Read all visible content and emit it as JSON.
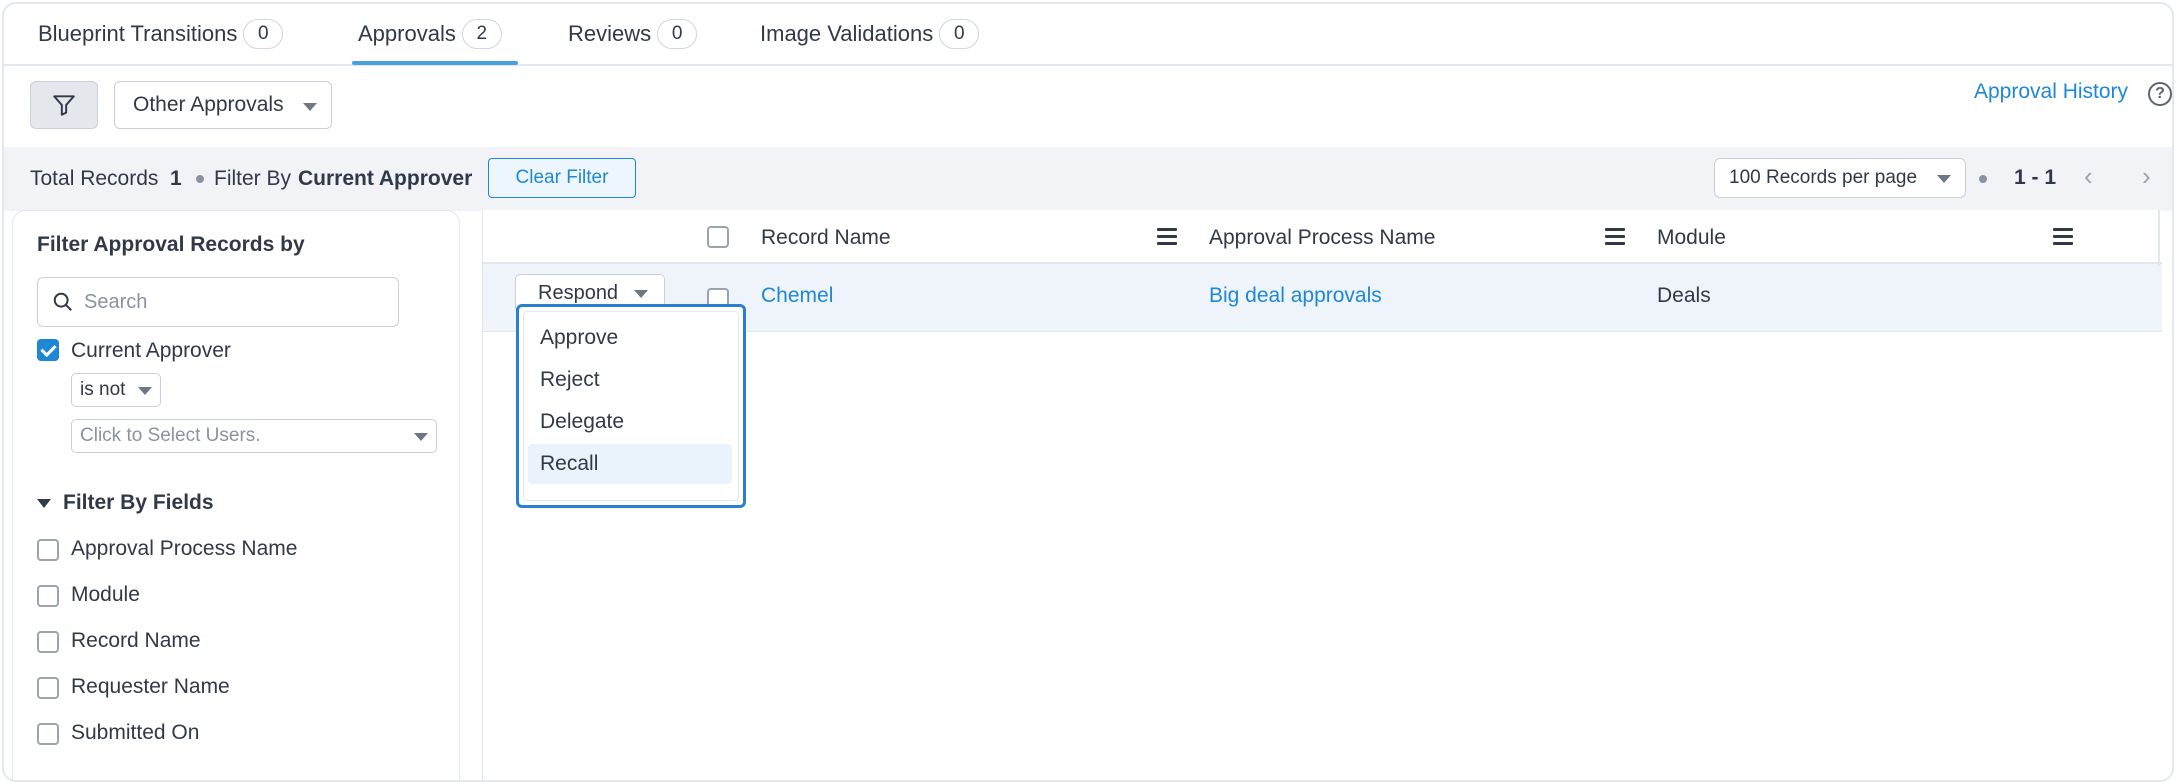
{
  "tabs": [
    {
      "label": "Blueprint Transitions",
      "count": "0"
    },
    {
      "label": "Approvals",
      "count": "2"
    },
    {
      "label": "Reviews",
      "count": "0"
    },
    {
      "label": "Image Validations",
      "count": "0"
    }
  ],
  "active_tab": "Approvals",
  "toolbar": {
    "filter_icon": "funnel-icon",
    "approvals_dropdown": "Other Approvals",
    "approval_history": "Approval History",
    "help_icon": "?"
  },
  "summary": {
    "total_label": "Total Records",
    "total_value": "1",
    "filter_by_label": "Filter By",
    "filter_by_value": "Current Approver",
    "clear_filter": "Clear Filter",
    "records_per_page": "100 Records per page",
    "range": "1 - 1"
  },
  "left_panel": {
    "title": "Filter Approval Records by",
    "search_placeholder": "Search",
    "current_approver": {
      "label": "Current Approver",
      "checked": true
    },
    "operator": "is not",
    "users_placeholder": "Click to Select Users.",
    "filter_by_fields": "Filter By Fields",
    "fields": [
      {
        "label": "Approval Process Name",
        "checked": false
      },
      {
        "label": "Module",
        "checked": false
      },
      {
        "label": "Record Name",
        "checked": false
      },
      {
        "label": "Requester Name",
        "checked": false
      },
      {
        "label": "Submitted On",
        "checked": false
      }
    ]
  },
  "table": {
    "columns": [
      "Record Name",
      "Approval Process Name",
      "Module"
    ],
    "rows": [
      {
        "action": "Respond",
        "record_name": "Chemel",
        "approval_process": "Big deal approvals",
        "module": "Deals"
      }
    ]
  },
  "respond_menu": {
    "items": [
      "Approve",
      "Reject",
      "Delegate",
      "Recall"
    ],
    "highlighted": "Recall"
  },
  "colors": {
    "accent": "#1e88d6",
    "highlight_border": "#2b7fd1"
  }
}
